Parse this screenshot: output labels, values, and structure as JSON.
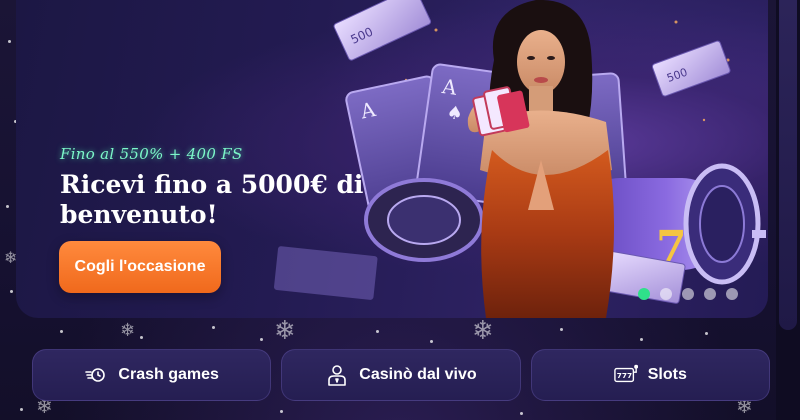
{
  "hero": {
    "promo_tag": "Fino al 550% + 400 FS",
    "headline": "Ricevi fino a 5000€ di benvenuto!",
    "cta_label": "Cogli l'occasione",
    "carousel": {
      "slide_count": 5,
      "active_index": 0
    }
  },
  "categories": [
    {
      "label": "Crash games",
      "icon": "rocket-speed-icon"
    },
    {
      "label": "Casinò dal vivo",
      "icon": "live-dealer-icon"
    },
    {
      "label": "Slots",
      "icon": "slot-777-icon"
    }
  ],
  "colors": {
    "accent_orange": "#f0691c",
    "promo_green": "#7cf7c9",
    "active_dot": "#2fe08a",
    "background": "#15102b",
    "nav_button": "#2a2359"
  }
}
